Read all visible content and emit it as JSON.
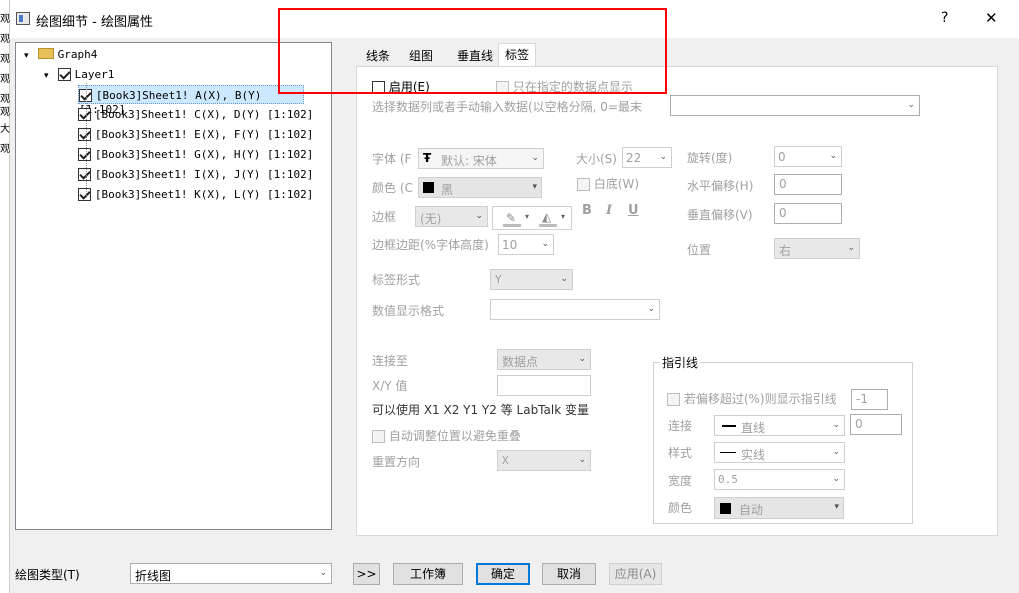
{
  "window": {
    "title": "绘图细节 - 绘图属性",
    "help_label": "?",
    "close_label": "✕",
    "left_fragments": [
      "观",
      "观",
      "观",
      "观",
      "观",
      "观",
      "大",
      "观"
    ]
  },
  "tree": {
    "root": "Graph4",
    "layer": "Layer1",
    "items": [
      "[Book3]Sheet1! A(X), B(Y) [1:102]",
      "[Book3]Sheet1! C(X), D(Y) [1:102]",
      "[Book3]Sheet1! E(X), F(Y) [1:102]",
      "[Book3]Sheet1! G(X), H(Y) [1:102]",
      "[Book3]Sheet1! I(X), J(Y) [1:102]",
      "[Book3]Sheet1! K(X), L(Y) [1:102]"
    ]
  },
  "tabs": [
    "线条",
    "组图",
    "垂直线",
    "标签"
  ],
  "label_tab": {
    "enable": "启用(E)",
    "only_specified": "只在指定的数据点显示",
    "select_data": "选择数据列或者手动输入数据(以空格分隔, 0=最末",
    "font_label": "字体 (F",
    "font_value": "默认: 宋体",
    "font_glyph": "Ŧ",
    "size_label": "大小(S)",
    "size_value": "22",
    "rotate_label": "旋转(度)",
    "rotate_value": "0",
    "color_label": "颜色 (C",
    "color_value": "黑",
    "white_bg": "白底(W)",
    "hoffset_label": "水平偏移(H)",
    "hoffset_value": "0",
    "border_label": "边框",
    "border_value": "(无)",
    "bold": "B",
    "italic": "I",
    "underline": "U",
    "voffset_label": "垂直偏移(V)",
    "voffset_value": "0",
    "margin_label": "边框边距(%字体高度)",
    "margin_value": "10",
    "position_label": "位置",
    "position_value": "右",
    "label_form_label": "标签形式",
    "label_form_value": "Y",
    "num_format_label": "数值显示格式",
    "connect_label": "连接至",
    "connect_value": "数据点",
    "xy_label": "X/Y 值",
    "variables_hint": "可以使用 X1 X2 Y1 Y2 等 LabTalk 变量",
    "auto_adjust": "自动调整位置以避免重叠",
    "reset_dir_label": "重置方向",
    "reset_dir_value": "X"
  },
  "leader": {
    "title": "指引线",
    "show_if": "若偏移超过(%)则显示指引线",
    "show_if_value": "-1",
    "connect_label": "连接",
    "connect_value": "直线",
    "connect_num": "0",
    "style_label": "样式",
    "style_value": "实线",
    "width_label": "宽度",
    "width_value": "0.5",
    "color_label": "颜色",
    "color_value": "自动"
  },
  "bottom": {
    "plot_type_label": "绘图类型(T)",
    "plot_type_value": "折线图",
    "expand": ">>",
    "workbook": "工作簿",
    "ok": "确定",
    "cancel": "取消",
    "apply": "应用(A)"
  },
  "colors": {
    "highlight": "#ff0000",
    "selected_row": "#cce8ff",
    "ok_border": "#0078d7"
  }
}
